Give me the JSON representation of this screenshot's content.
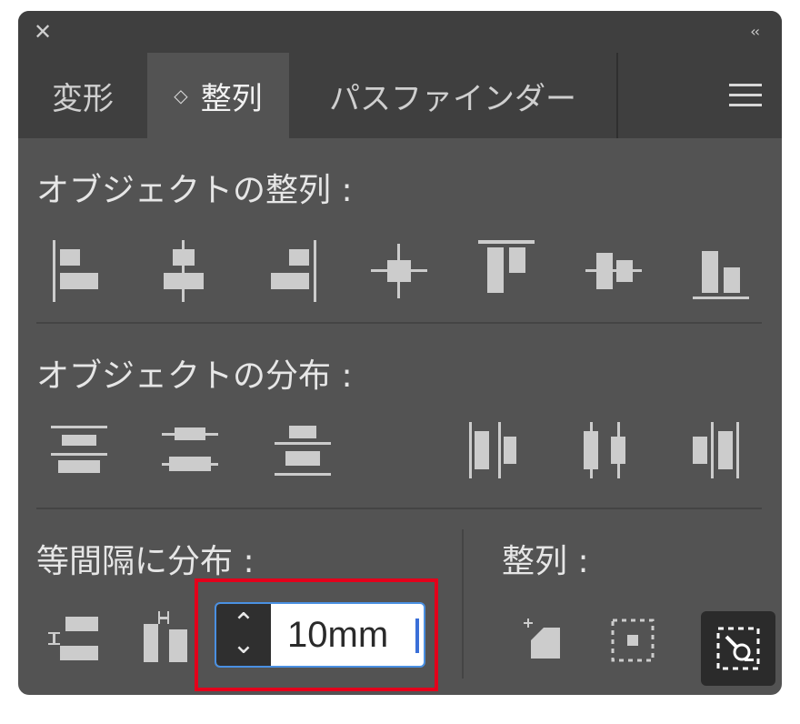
{
  "titlebar": {
    "close_icon": "✕",
    "collapse_icon": "‹‹"
  },
  "tabs": [
    {
      "label": "変形",
      "active": false
    },
    {
      "label": "整列",
      "active": true,
      "icon": "◇"
    },
    {
      "label": "パスファインダー",
      "active": false
    }
  ],
  "sections": {
    "align_objects": "オブジェクトの整列 :",
    "distribute_objects": "オブジェクトの分布 :",
    "distribute_spacing": "等間隔に分布 :",
    "align_to": "整列 :"
  },
  "spacing": {
    "value": "10mm",
    "up_icon": "⌃",
    "down_icon": "⌄"
  },
  "icons": {
    "align_objects": [
      "align-left-icon",
      "align-horizontal-center-icon",
      "align-right-icon",
      "align-center-both-icon",
      "align-top-icon",
      "align-vertical-center-icon",
      "align-bottom-icon"
    ],
    "distribute_objects": [
      "distribute-top-icon",
      "distribute-vertical-center-icon",
      "distribute-bottom-icon",
      "distribute-left-icon",
      "distribute-horizontal-center-icon",
      "distribute-right-icon"
    ],
    "distribute_spacing": [
      "vertical-distribute-space-icon",
      "horizontal-distribute-space-icon"
    ],
    "align_to": [
      "align-to-selection-icon",
      "align-to-artboard-icon",
      "align-to-key-object-icon"
    ]
  },
  "colors": {
    "panel_bg": "#535353",
    "tabbar_bg": "#3f3f3f",
    "icon": "#cccccc",
    "focus": "#4a90e2",
    "highlight": "#e3001b"
  }
}
